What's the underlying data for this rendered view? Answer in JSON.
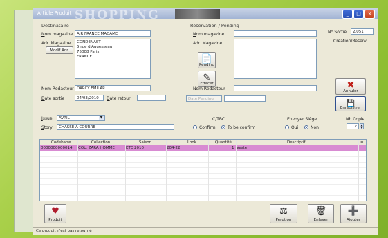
{
  "window": {
    "title": "Article Produit",
    "title_ghost": "SHOPPING",
    "buttons": [
      "_",
      "□",
      "×"
    ]
  },
  "destinataire": {
    "section_label": "Destinataire",
    "nom_magazine_label": "Nom magazine",
    "nom_magazine_value": "AIR FRANCE MADAME",
    "adr_magazine_label": "Adr. Magazine",
    "modif_adr_label": "Modif Adr.",
    "address_lines": [
      "CONDENAST",
      "5 rue d'Aguesseau",
      "75008 Paris",
      "FRANCE"
    ],
    "nom_redacteur_label": "Nom Redacteur",
    "nom_redacteur_value": "DARCY EMILAR",
    "date_sortie_label": "Date sortie",
    "date_sortie_value": "04/03/2010",
    "date_retour_label": "Date retour",
    "date_retour_value": ""
  },
  "reservation": {
    "section_label": "Reservation / Pending",
    "nom_magazine_label": "Nom magazine",
    "adr_magazine_label": "Adr. Magazine",
    "pending_label": "Pending",
    "effacer_label": "Effacer",
    "nom_redacteur_label": "Nom Redacteur",
    "date_pending_placeholder": "Date Pending"
  },
  "sortie": {
    "no_sortie_label": "N° Sortie",
    "no_sortie_value": "2.051",
    "creation_label": "Création/Reserv."
  },
  "actions": {
    "annuler_label": "Annuler",
    "enregistrer_label": "Enregistrer"
  },
  "issue": {
    "issue_label": "Issue",
    "issue_value": "AVRIL",
    "story_label": "Story",
    "story_value": "CHASSE A COURRE"
  },
  "ctbc": {
    "label": "C/TBC",
    "confirm_label": "Confirm",
    "to_be_confirm_label": "To be confirm"
  },
  "envoyer_siege": {
    "label": "Envoyer Siège",
    "oui_label": "Oui",
    "non_label": "Non"
  },
  "nb_copie": {
    "label": "Nb Copie",
    "value": "2"
  },
  "grid": {
    "headers": [
      "Codebarre",
      "Collection",
      "Saison",
      "Look",
      "Quantité",
      "Descriptif"
    ],
    "rows": [
      [
        "0000000000014",
        "COL. ZARA HOMME",
        "ETE 2010",
        "204-22",
        "1",
        "Veste"
      ]
    ]
  },
  "bottom": {
    "produit_label": "Produit",
    "perution_label": "Perution",
    "enlever_label": "Enlever",
    "ajouter_label": "Ajouter"
  },
  "status": {
    "text": "Ce produit n'est pas retourné"
  },
  "colors": {
    "selected_row": "#d88bd2",
    "background": "#9ec63c",
    "window": "#ece9d8"
  }
}
